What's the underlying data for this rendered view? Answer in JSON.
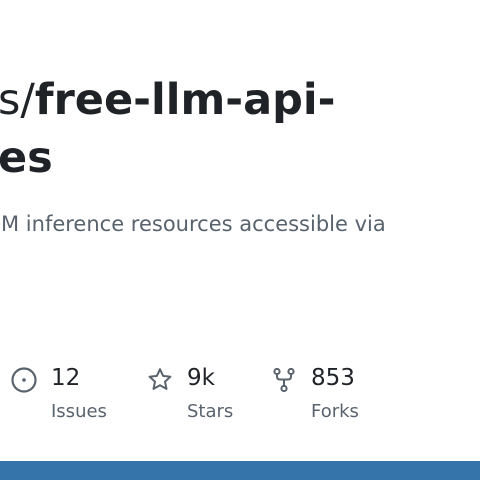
{
  "repo": {
    "title_line_1_prefix": "s/",
    "title_line_1_name": "free-llm-api-",
    "title_line_2": "es",
    "description": "M inference resources accessible via"
  },
  "stats": {
    "issues": {
      "count": "12",
      "label": "Issues",
      "icon": "issue-opened-icon"
    },
    "stars": {
      "count": "9k",
      "label": "Stars",
      "icon": "star-icon"
    },
    "forks": {
      "count": "853",
      "label": "Forks",
      "icon": "repo-forked-icon"
    }
  },
  "colors": {
    "title": "#1f2328",
    "muted_text": "#59636e",
    "bottom_bar": "#3574aa"
  }
}
